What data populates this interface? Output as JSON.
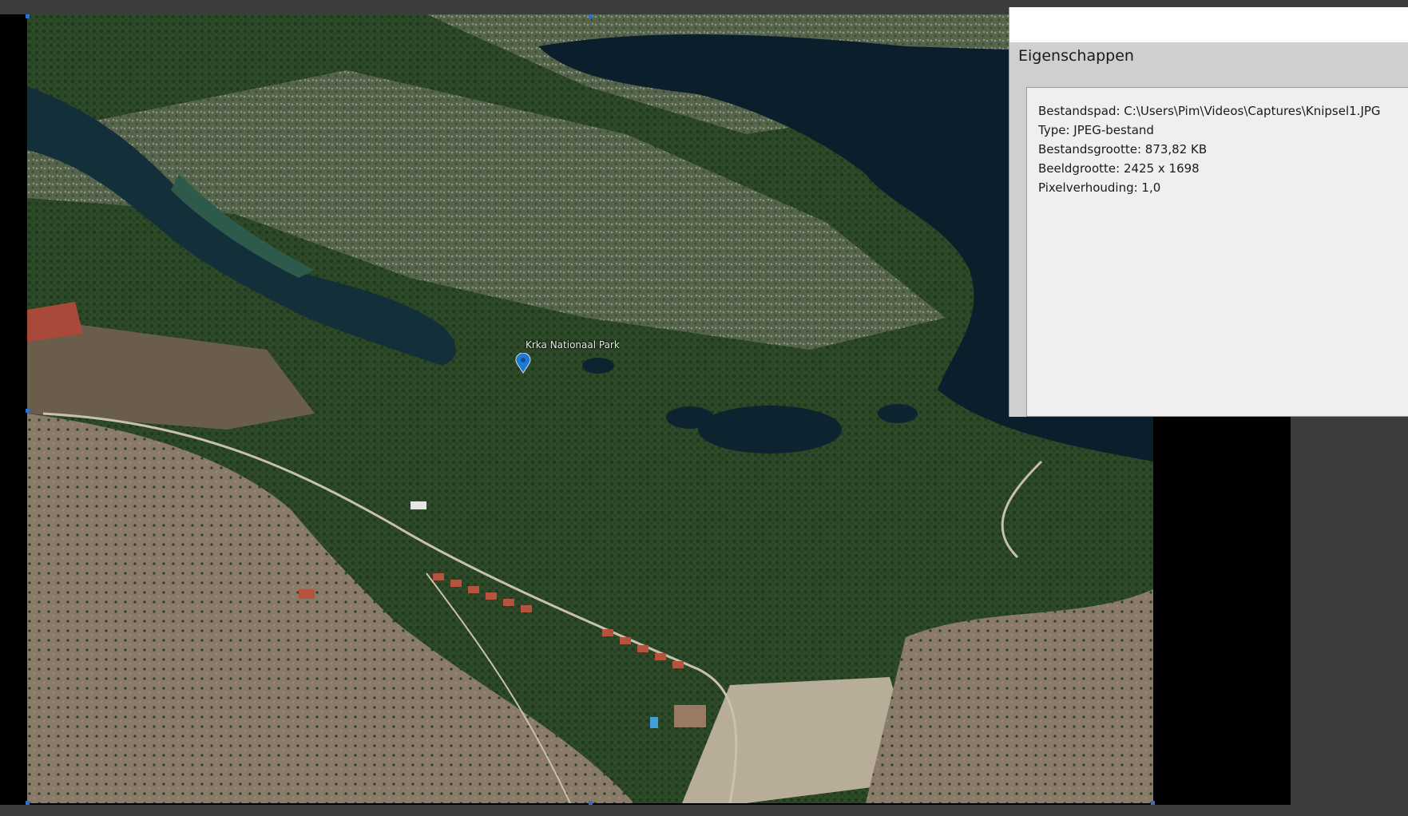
{
  "photo": {
    "map_label": "Krka Nationaal Park",
    "pin_color": "#1f78d1"
  },
  "properties": {
    "title": "Eigenschappen",
    "lines": [
      "Bestandspad: C:\\Users\\Pim\\Videos\\Captures\\Knipsel1.JPG",
      "Type: JPEG-bestand",
      "Bestandsgrootte: 873,82 KB",
      "Beeldgrootte: 2425 x 1698",
      "Pixelverhouding: 1,0"
    ]
  }
}
